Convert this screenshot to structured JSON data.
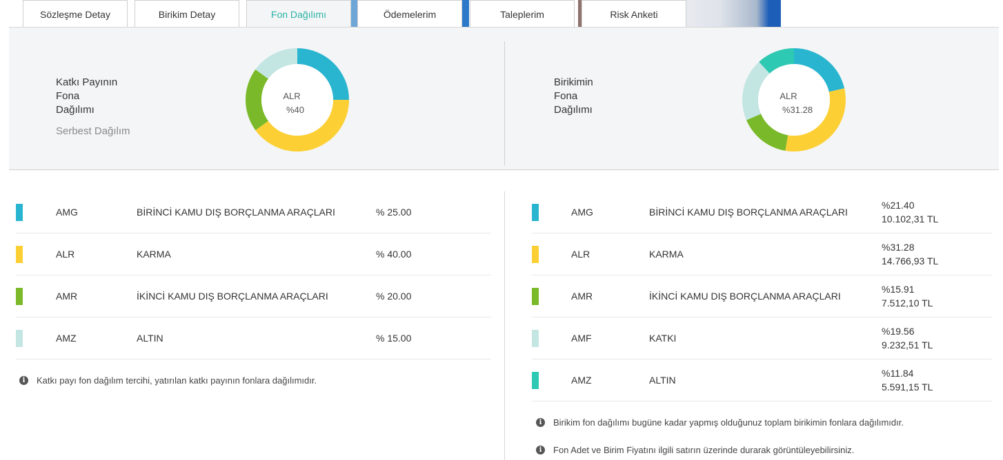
{
  "tabs": [
    {
      "label": "Sözleşme Detay"
    },
    {
      "label": "Birikim Detay"
    },
    {
      "label": "Fon Dağılımı"
    },
    {
      "label": "Ödemelerim"
    },
    {
      "label": "Taleplerim"
    },
    {
      "label": "Risk Anketi"
    }
  ],
  "active_tab": "Fon Dağılımı",
  "colors": {
    "AMG": "#29b5d0",
    "ALR": "#fcd034",
    "AMR": "#7ab929",
    "AMZ_left": "#c3e6e3",
    "AMF": "#c3e6e3",
    "AMZ_right": "#2ec9b3",
    "accent_tab": "#2ab3a6"
  },
  "left_chart": {
    "title_lines": [
      "Katkı Payının",
      "Fona",
      "Dağılımı"
    ],
    "subtitle": "Serbest Dağılım",
    "center_code": "ALR",
    "center_pct": "%40"
  },
  "right_chart": {
    "title_lines": [
      "Birikimin",
      "Fona",
      "Dağılımı"
    ],
    "center_code": "ALR",
    "center_pct": "%31.28"
  },
  "chart_data": [
    {
      "type": "pie",
      "title": "Katkı Payının Fona Dağılımı",
      "categories": [
        "AMG",
        "ALR",
        "AMR",
        "AMZ"
      ],
      "values": [
        25,
        40,
        20,
        15
      ]
    },
    {
      "type": "pie",
      "title": "Birikimin Fona Dağılımı",
      "categories": [
        "AMG",
        "ALR",
        "AMR",
        "AMF",
        "AMZ"
      ],
      "values": [
        21.4,
        31.28,
        15.91,
        19.56,
        11.84
      ]
    }
  ],
  "left_table": [
    {
      "code": "AMG",
      "name": "BİRİNCİ KAMU DIŞ BORÇLANMA ARAÇLARI",
      "pct": "% 25.00",
      "color_key": "AMG"
    },
    {
      "code": "ALR",
      "name": "KARMA",
      "pct": "% 40.00",
      "color_key": "ALR"
    },
    {
      "code": "AMR",
      "name": "İKİNCİ KAMU DIŞ BORÇLANMA ARAÇLARI",
      "pct": "% 20.00",
      "color_key": "AMR"
    },
    {
      "code": "AMZ",
      "name": "ALTIN",
      "pct": "% 15.00",
      "color_key": "AMZ_left"
    }
  ],
  "right_table": [
    {
      "code": "AMG",
      "name": "BİRİNCİ KAMU DIŞ BORÇLANMA ARAÇLARI",
      "pct": "%21.40",
      "amount": "10.102,31 TL",
      "color_key": "AMG"
    },
    {
      "code": "ALR",
      "name": "KARMA",
      "pct": "%31.28",
      "amount": "14.766,93 TL",
      "color_key": "ALR"
    },
    {
      "code": "AMR",
      "name": "İKİNCİ KAMU DIŞ BORÇLANMA ARAÇLARI",
      "pct": "%15.91",
      "amount": "7.512,10 TL",
      "color_key": "AMR"
    },
    {
      "code": "AMF",
      "name": "KATKI",
      "pct": "%19.56",
      "amount": "9.232,51 TL",
      "color_key": "AMF"
    },
    {
      "code": "AMZ",
      "name": "ALTIN",
      "pct": "%11.84",
      "amount": "5.591,15 TL",
      "color_key": "AMZ_right"
    }
  ],
  "notes": {
    "left": "Katkı payı fon dağılım tercihi, yatırılan katkı payının fonlara dağılımıdır.",
    "right_1": "Birikim fon dağılımı bugüne kadar yapmış olduğunuz toplam birikimin fonlara dağılımıdır.",
    "right_2": "Fon Adet ve Birim Fiyatını ilgili satırın üzerinde durarak görüntüleyebilirsiniz."
  },
  "info_icon_glyph": "i"
}
